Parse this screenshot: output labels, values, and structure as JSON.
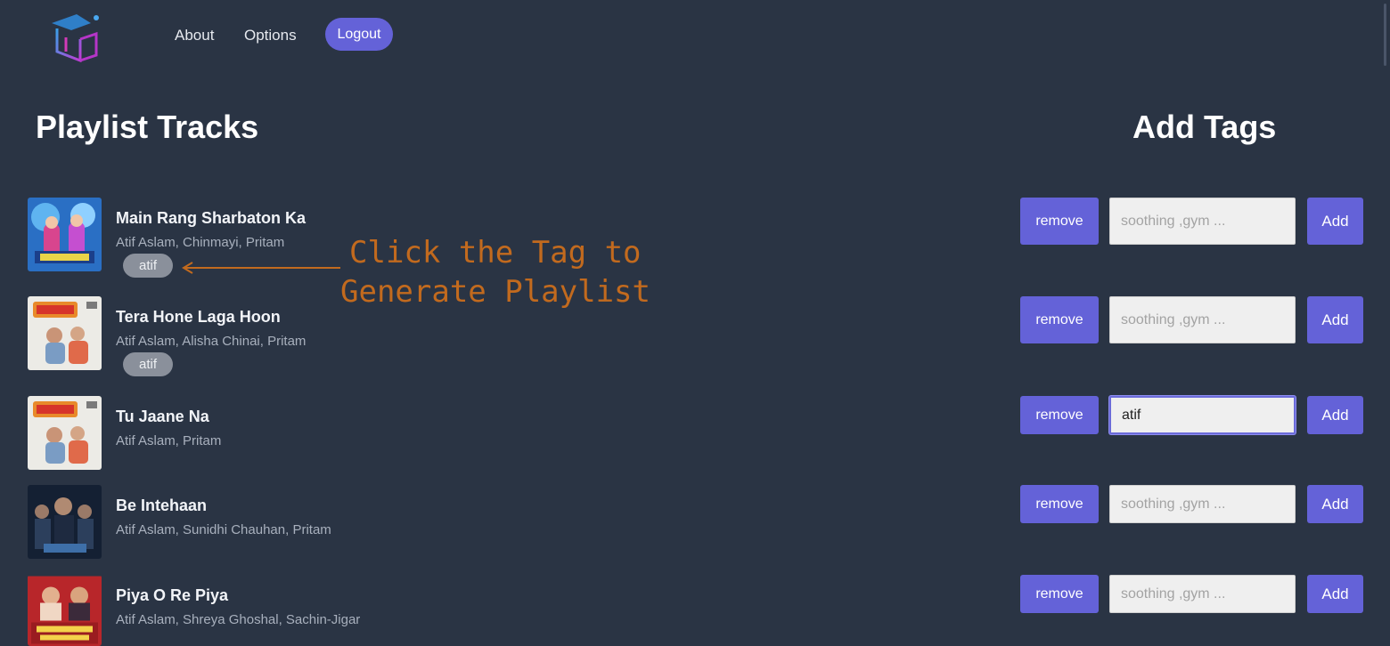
{
  "nav": {
    "about": "About",
    "options": "Options",
    "logout": "Logout"
  },
  "headings": {
    "playlist": "Playlist Tracks",
    "tags": "Add Tags"
  },
  "annotation": {
    "line1": "Click the Tag to",
    "line2": "Generate Playlist",
    "color": "#c26a1e"
  },
  "colors": {
    "background": "#2a3444",
    "accent": "#6462d8",
    "chip": "#8a909b"
  },
  "controls": {
    "remove_label": "remove",
    "add_label": "Add",
    "placeholder": "soothing ,gym ..."
  },
  "tracks": [
    {
      "title": "Main Rang Sharbaton Ka",
      "artists": "Atif Aslam, Chinmayi, Pritam",
      "tag": "atif",
      "input_value": "",
      "cover_icon": "album-cover-blue"
    },
    {
      "title": "Tera Hone Laga Hoon",
      "artists": "Atif Aslam, Alisha Chinai, Pritam",
      "tag": "atif",
      "input_value": "",
      "cover_icon": "album-cover-light"
    },
    {
      "title": "Tu Jaane Na",
      "artists": "Atif Aslam, Pritam",
      "input_value": "atif",
      "cover_icon": "album-cover-light"
    },
    {
      "title": "Be Intehaan",
      "artists": "Atif Aslam, Sunidhi Chauhan, Pritam",
      "input_value": "",
      "cover_icon": "album-cover-dark"
    },
    {
      "title": "Piya O Re Piya",
      "artists": "Atif Aslam, Shreya Ghoshal, Sachin-Jigar",
      "input_value": "",
      "cover_icon": "album-cover-red"
    }
  ]
}
